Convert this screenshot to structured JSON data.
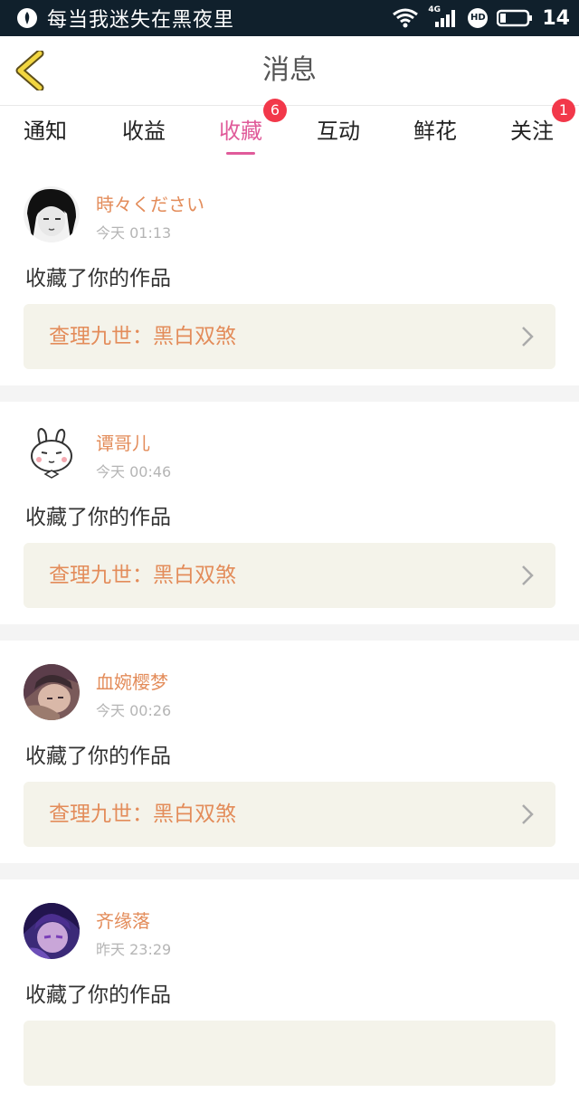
{
  "status_bar": {
    "title": "每当我迷失在黑夜里",
    "time": "14",
    "network_label": "4G",
    "hd_label": "HD"
  },
  "header": {
    "title": "消息"
  },
  "tabs": [
    {
      "label": "通知",
      "badge": ""
    },
    {
      "label": "收益",
      "badge": ""
    },
    {
      "label": "收藏",
      "badge": "6",
      "active": true
    },
    {
      "label": "互动",
      "badge": ""
    },
    {
      "label": "鲜花",
      "badge": ""
    },
    {
      "label": "关注",
      "badge": "1"
    }
  ],
  "messages": [
    {
      "username": "時々ください",
      "time": "今天 01:13",
      "action": "收藏了你的作品",
      "work": "查理九世：黑白双煞",
      "avatar": "avatar-bw-hair"
    },
    {
      "username": "谭哥儿",
      "time": "今天 00:46",
      "action": "收藏了你的作品",
      "work": "查理九世：黑白双煞",
      "avatar": "avatar-bunny"
    },
    {
      "username": "血婉樱梦",
      "time": "今天 00:26",
      "action": "收藏了你的作品",
      "work": "查理九世：黑白双煞",
      "avatar": "avatar-anime-brown"
    },
    {
      "username": "齐缘落",
      "time": "昨天 23:29",
      "action": "收藏了你的作品",
      "work": "",
      "avatar": "avatar-anime-purple"
    }
  ],
  "colors": {
    "accent": "#e05b9a",
    "name_orange": "#e38c5a",
    "badge_red": "#f2384a",
    "work_bg": "#f4f3ea"
  }
}
